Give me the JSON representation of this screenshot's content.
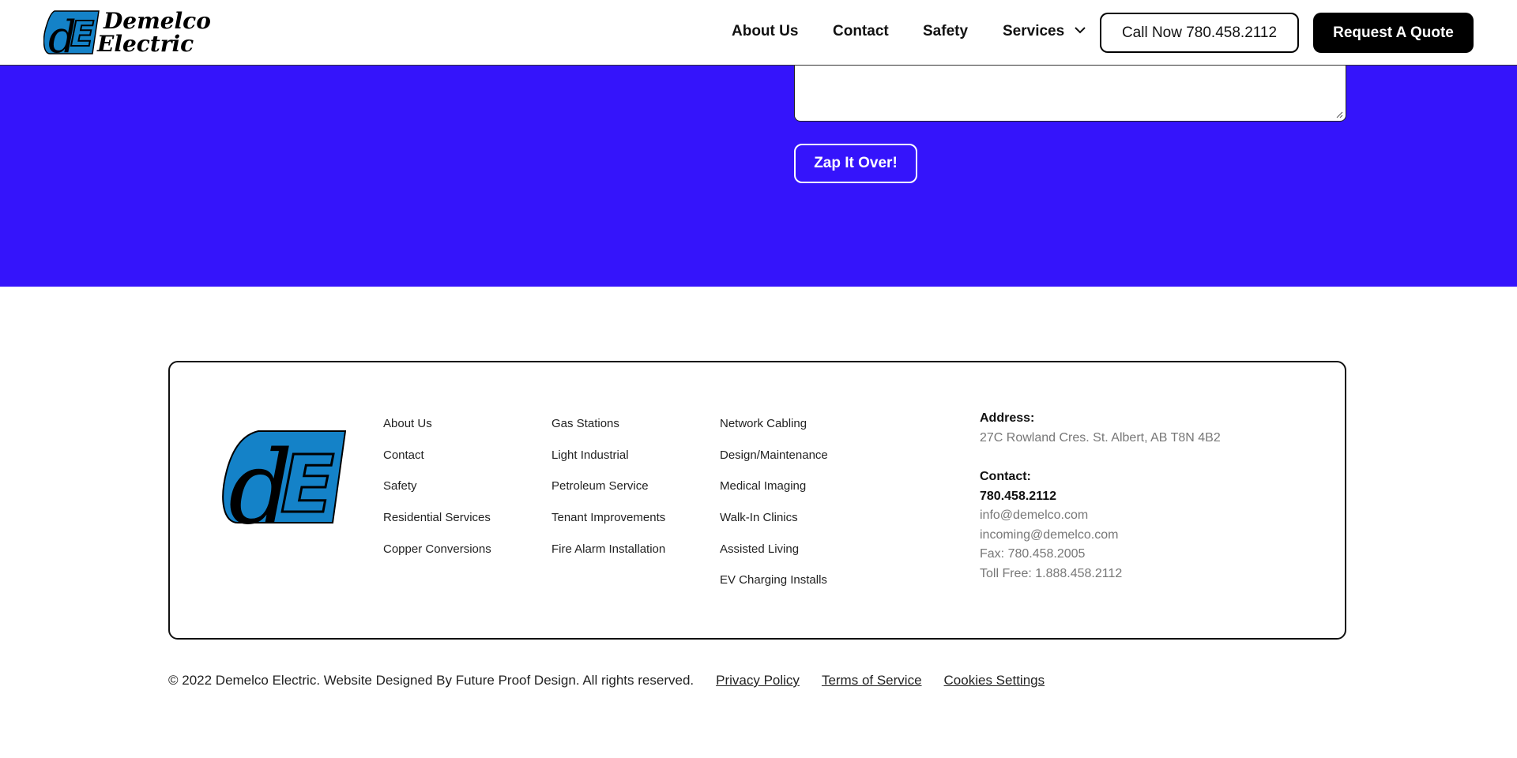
{
  "brand": {
    "name_line1": "Demelco",
    "name_line2": "Electric",
    "colors": {
      "logo_blue": "#1482c8",
      "section_blue": "#3514fb",
      "black": "#000000"
    }
  },
  "header": {
    "nav": {
      "about": "About Us",
      "contact": "Contact",
      "safety": "Safety",
      "services": "Services"
    },
    "call_button": "Call Now 780.458.2112",
    "quote_button": "Request A Quote",
    "services_icon": "chevron-down-icon"
  },
  "form": {
    "submit_label": "Zap It Over!"
  },
  "footer": {
    "links_col1": [
      "About Us",
      "Contact",
      "Safety",
      "Residential Services",
      "Copper Conversions"
    ],
    "links_col2": [
      "Gas Stations",
      "Light Industrial",
      "Petroleum Service",
      "Tenant Improvements",
      "Fire Alarm Installation"
    ],
    "links_col3": [
      "Network Cabling",
      "Design/Maintenance",
      "Medical Imaging",
      "Walk-In Clinics",
      "Assisted Living",
      "EV Charging Installs"
    ],
    "address_label": "Address:",
    "address": "27C Rowland Cres. St. Albert, AB T8N 4B2",
    "contact_label": "Contact:",
    "phone": "780.458.2112",
    "email1": "info@demelco.com",
    "email2": "incoming@demelco.com",
    "fax": "Fax: 780.458.2005",
    "toll_free": "Toll Free: 1.888.458.2112"
  },
  "bottom": {
    "copyright": "© 2022 Demelco Electric. Website Designed By Future Proof Design. All rights reserved.",
    "privacy": "Privacy Policy",
    "terms": "Terms of Service",
    "cookies": "Cookies Settings"
  }
}
